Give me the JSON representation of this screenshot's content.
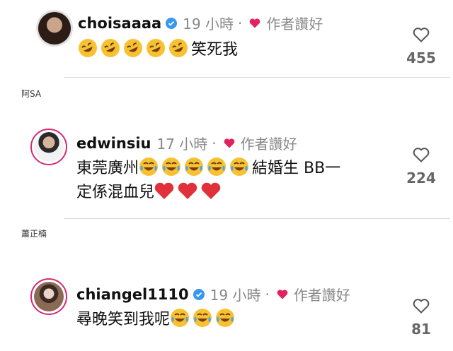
{
  "comments": [
    {
      "username": "choisaaaa",
      "time": "19 小時",
      "dot": "·",
      "author_liked": "作者讚好",
      "lines": [
        {
          "emoji_count": 5,
          "text": "笑死我"
        }
      ],
      "likes": "455",
      "verified": true
    },
    {
      "username": "edwinsiu",
      "time": "17 小時",
      "dot": "·",
      "author_liked": "作者讚好",
      "line1_prefix": "東莞廣州",
      "line1_suffix": "結婚生 BB一",
      "line2_text": "定係混血兒",
      "likes": "224",
      "verified": false
    },
    {
      "username": "chiangel1110",
      "time": "19 小時",
      "dot": "·",
      "author_liked": "作者讚好",
      "text": "尋晚笑到我呢",
      "likes": "81",
      "verified": true
    }
  ],
  "captions": [
    "阿SA",
    "蕭正楠"
  ],
  "colors": {
    "heart_red": "#e0245e",
    "verified_blue": "#3897f0",
    "story_ring": "#d62976"
  }
}
